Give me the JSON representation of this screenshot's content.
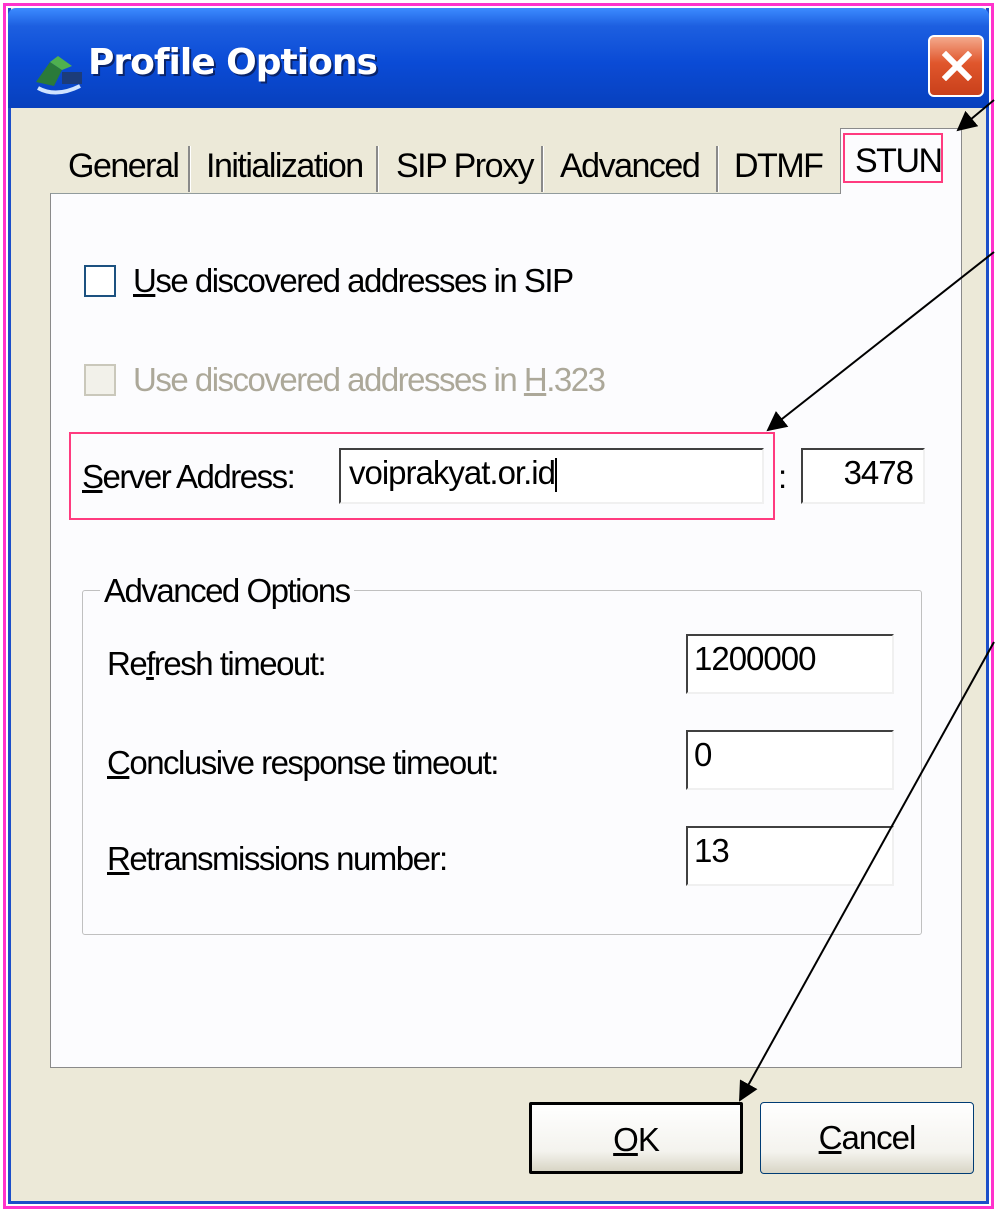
{
  "window": {
    "title": "Profile Options",
    "close_icon": "close-x-icon",
    "app_icon": "phone-satellite-icon"
  },
  "tabs": [
    {
      "label": "General",
      "active": false
    },
    {
      "label": "Initialization",
      "active": false
    },
    {
      "label": "SIP Proxy",
      "active": false
    },
    {
      "label": "Advanced",
      "active": false
    },
    {
      "label": "DTMF",
      "active": false
    },
    {
      "label": "STUN",
      "active": true
    }
  ],
  "stun": {
    "use_sip": {
      "label_access": "U",
      "label_rest": "se discovered addresses in SIP",
      "checked": false,
      "enabled": true
    },
    "use_h323": {
      "label_before": "Use discovered addresses in ",
      "label_access": "H",
      "label_after": ".323",
      "checked": false,
      "enabled": false
    },
    "server": {
      "label_access": "S",
      "label_rest": "erver Address:",
      "value": "voiprakyat.or.id",
      "port_sep": ":",
      "port": "3478"
    },
    "advanced": {
      "title": "Advanced Options",
      "refresh": {
        "label_before": "Re",
        "label_access": "f",
        "label_after": "resh timeout:",
        "value": "1200000"
      },
      "conclusive": {
        "label_access": "C",
        "label_rest": "onclusive response timeout:",
        "value": "0"
      },
      "retrans": {
        "label_access": "R",
        "label_rest": "etransmissions number:",
        "value": "13"
      }
    }
  },
  "buttons": {
    "ok": {
      "access": "O",
      "rest": "K"
    },
    "cancel": {
      "access": "C",
      "rest": "ancel"
    }
  },
  "colors": {
    "annotation_highlight": "#ff3b7f",
    "outer_border": "#ff33cc",
    "titlebar_blue": "#0a4bd6",
    "dialog_bg": "#ece9d8"
  }
}
